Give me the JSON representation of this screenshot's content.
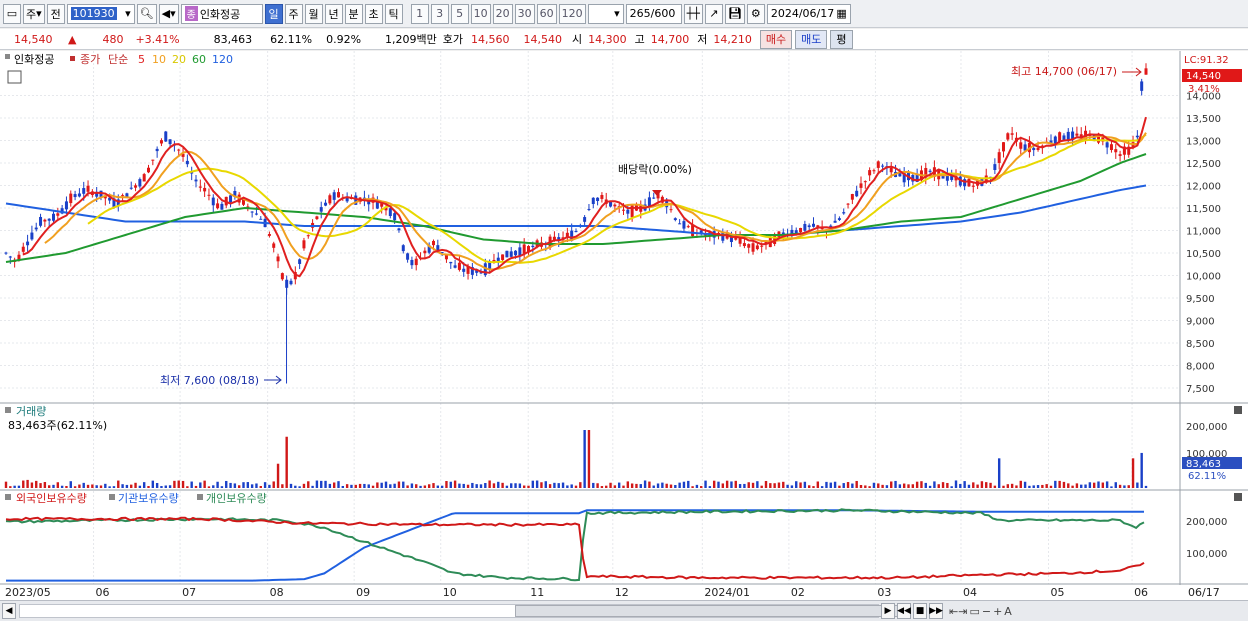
{
  "toolbar": {
    "market_a": "주",
    "market_b": "전",
    "code": "101930",
    "name_badge": "종",
    "name": "인화정공",
    "periods": [
      "일",
      "주",
      "월",
      "년",
      "분",
      "초",
      "틱"
    ],
    "numbers": [
      "1",
      "3",
      "5",
      "10",
      "20",
      "30",
      "60",
      "120"
    ],
    "count": "265",
    "count_total": "/600",
    "date": "2024/06/17"
  },
  "quote": {
    "price": "14,540",
    "change": "480",
    "change_pct": "+3.41%",
    "volume": "83,463",
    "vol_ratio": "62.11%",
    "turnover": "0.92%",
    "amount": "1,209백만",
    "ask_label": "호가",
    "ask": "14,560",
    "bid": "14,540",
    "open_label": "시",
    "open": "14,300",
    "high_label": "고",
    "high": "14,700",
    "low_label": "저",
    "low": "14,210",
    "buy": "매수",
    "sell": "매도",
    "eval": "평"
  },
  "legend": {
    "name": "인화정공",
    "close_label": "종가",
    "simple_label": "단순",
    "ma": [
      {
        "label": "5",
        "color": "#e02020"
      },
      {
        "label": "10",
        "color": "#f0a020"
      },
      {
        "label": "20",
        "color": "#e8d800"
      },
      {
        "label": "60",
        "color": "#209a30"
      },
      {
        "label": "120",
        "color": "#2060e0"
      }
    ]
  },
  "annotations": {
    "lc": "LC:91.32",
    "max": "최고 14,700 (06/17)",
    "min": "최저 7,600 (08/18)",
    "dividend": "배당락(0.00%)",
    "price_tag": "14,540",
    "pct_tag": "3.41%"
  },
  "volume_panel": {
    "title": "거래량",
    "value": "83,463주(62.11%)",
    "tag": "83,463",
    "tag_pct": "62.11%",
    "ticks": [
      "200,000",
      "100,000"
    ]
  },
  "holder_panel": {
    "series": [
      "외국인보유수량",
      "기관보유수량",
      "개인보유수량"
    ],
    "colors": [
      "#d01818",
      "#2060e0",
      "#2e8b57"
    ],
    "ticks": [
      "200,000",
      "100,000"
    ]
  },
  "x_axis": {
    "labels": [
      "2023/05",
      "06",
      "07",
      "08",
      "09",
      "10",
      "11",
      "12",
      "2024/01",
      "02",
      "03",
      "04",
      "05",
      "06",
      "06/17"
    ]
  },
  "y_axis": {
    "price_ticks": [
      "14,000",
      "13,500",
      "13,000",
      "12,500",
      "12,000",
      "11,500",
      "11,000",
      "10,500",
      "10,000",
      "9,500",
      "9,000",
      "8,500",
      "8,000",
      "7,500"
    ]
  },
  "chart_data": {
    "type": "candlestick",
    "title": "",
    "ylim": [
      7300,
      14900
    ],
    "price_trend": [
      [
        0,
        10500
      ],
      [
        10,
        10300
      ],
      [
        20,
        10700
      ],
      [
        35,
        11200
      ],
      [
        50,
        11300
      ],
      [
        65,
        11700
      ],
      [
        80,
        11900
      ],
      [
        95,
        11800
      ],
      [
        110,
        11600
      ],
      [
        125,
        11900
      ],
      [
        140,
        12200
      ],
      [
        150,
        12700
      ],
      [
        160,
        13100
      ],
      [
        170,
        12900
      ],
      [
        180,
        12600
      ],
      [
        190,
        12100
      ],
      [
        200,
        11900
      ],
      [
        215,
        11500
      ],
      [
        230,
        11800
      ],
      [
        245,
        11500
      ],
      [
        260,
        11200
      ],
      [
        270,
        10600
      ],
      [
        280,
        9800
      ],
      [
        290,
        9900
      ],
      [
        300,
        10700
      ],
      [
        315,
        11400
      ],
      [
        330,
        11800
      ],
      [
        345,
        11700
      ],
      [
        360,
        11700
      ],
      [
        375,
        11600
      ],
      [
        390,
        11400
      ],
      [
        400,
        10600
      ],
      [
        410,
        10200
      ],
      [
        420,
        10500
      ],
      [
        430,
        10700
      ],
      [
        440,
        10500
      ],
      [
        450,
        10200
      ],
      [
        465,
        10100
      ],
      [
        480,
        10100
      ],
      [
        495,
        10400
      ],
      [
        510,
        10500
      ],
      [
        525,
        10600
      ],
      [
        540,
        10700
      ],
      [
        555,
        10800
      ],
      [
        570,
        10900
      ],
      [
        580,
        11200
      ],
      [
        590,
        11700
      ],
      [
        600,
        11700
      ],
      [
        615,
        11500
      ],
      [
        625,
        11400
      ],
      [
        640,
        11500
      ],
      [
        655,
        11800
      ],
      [
        665,
        11600
      ],
      [
        675,
        11200
      ],
      [
        690,
        11000
      ],
      [
        705,
        10900
      ],
      [
        720,
        10900
      ],
      [
        735,
        10800
      ],
      [
        750,
        10600
      ],
      [
        765,
        10700
      ],
      [
        780,
        10900
      ],
      [
        795,
        11000
      ],
      [
        810,
        11100
      ],
      [
        825,
        11000
      ],
      [
        840,
        11300
      ],
      [
        850,
        11700
      ],
      [
        860,
        12000
      ],
      [
        870,
        12300
      ],
      [
        880,
        12500
      ],
      [
        890,
        12300
      ],
      [
        900,
        12200
      ],
      [
        915,
        12200
      ],
      [
        930,
        12300
      ],
      [
        945,
        12200
      ],
      [
        960,
        12100
      ],
      [
        975,
        12000
      ],
      [
        990,
        12200
      ],
      [
        1000,
        12700
      ],
      [
        1010,
        13200
      ],
      [
        1020,
        12900
      ],
      [
        1035,
        12800
      ],
      [
        1050,
        13000
      ],
      [
        1065,
        13100
      ],
      [
        1080,
        13100
      ],
      [
        1095,
        13100
      ],
      [
        1110,
        12900
      ],
      [
        1120,
        12700
      ],
      [
        1130,
        12800
      ],
      [
        1137,
        13000
      ],
      [
        1142,
        14300
      ],
      [
        1146,
        14540
      ]
    ],
    "ma60": [
      [
        0,
        10300
      ],
      [
        60,
        10500
      ],
      [
        120,
        10900
      ],
      [
        180,
        11300
      ],
      [
        240,
        11500
      ],
      [
        300,
        11400
      ],
      [
        360,
        11300
      ],
      [
        420,
        11100
      ],
      [
        480,
        10800
      ],
      [
        540,
        10700
      ],
      [
        600,
        10700
      ],
      [
        660,
        10800
      ],
      [
        720,
        10900
      ],
      [
        780,
        10900
      ],
      [
        840,
        11000
      ],
      [
        900,
        11200
      ],
      [
        960,
        11300
      ],
      [
        1020,
        11700
      ],
      [
        1080,
        12100
      ],
      [
        1120,
        12500
      ],
      [
        1146,
        12700
      ]
    ],
    "ma120": [
      [
        0,
        11600
      ],
      [
        60,
        11400
      ],
      [
        120,
        11200
      ],
      [
        180,
        11200
      ],
      [
        240,
        11200
      ],
      [
        300,
        11100
      ],
      [
        360,
        11100
      ],
      [
        420,
        11100
      ],
      [
        480,
        11100
      ],
      [
        540,
        11100
      ],
      [
        600,
        11100
      ],
      [
        660,
        11000
      ],
      [
        720,
        10900
      ],
      [
        780,
        10900
      ],
      [
        840,
        11000
      ],
      [
        900,
        11100
      ],
      [
        960,
        11200
      ],
      [
        1020,
        11400
      ],
      [
        1080,
        11700
      ],
      [
        1120,
        11900
      ],
      [
        1146,
        12000
      ]
    ],
    "volume_spikes": [
      [
        20,
        30000
      ],
      [
        272,
        90000
      ],
      [
        282,
        190000
      ],
      [
        584,
        215000
      ],
      [
        998,
        110000
      ],
      [
        1133,
        110000
      ],
      [
        1140,
        130000
      ]
    ],
    "foreign": [
      [
        0,
        220000
      ],
      [
        100,
        220000
      ],
      [
        200,
        220000
      ],
      [
        300,
        205000
      ],
      [
        360,
        203000
      ],
      [
        420,
        200000
      ],
      [
        500,
        200000
      ],
      [
        578,
        200000
      ],
      [
        580,
        80000
      ],
      [
        582,
        20000
      ],
      [
        700,
        15000
      ],
      [
        800,
        15000
      ],
      [
        900,
        15000
      ],
      [
        980,
        25000
      ],
      [
        1060,
        30000
      ],
      [
        1120,
        40000
      ],
      [
        1146,
        65000
      ]
    ],
    "institution": [
      [
        0,
        5000
      ],
      [
        250,
        5000
      ],
      [
        300,
        10000
      ],
      [
        320,
        30000
      ],
      [
        360,
        120000
      ],
      [
        420,
        200000
      ],
      [
        450,
        240000
      ],
      [
        500,
        240000
      ],
      [
        578,
        240000
      ],
      [
        582,
        250000
      ],
      [
        700,
        250000
      ],
      [
        850,
        250000
      ],
      [
        980,
        245000
      ],
      [
        1146,
        245000
      ]
    ],
    "individual": [
      [
        0,
        210000
      ],
      [
        100,
        215000
      ],
      [
        200,
        220000
      ],
      [
        280,
        215000
      ],
      [
        320,
        190000
      ],
      [
        360,
        140000
      ],
      [
        420,
        70000
      ],
      [
        450,
        30000
      ],
      [
        500,
        15000
      ],
      [
        578,
        10000
      ],
      [
        580,
        150000
      ],
      [
        582,
        240000
      ],
      [
        700,
        245000
      ],
      [
        850,
        250000
      ],
      [
        980,
        240000
      ],
      [
        1000,
        215000
      ],
      [
        1060,
        215000
      ],
      [
        1120,
        215000
      ],
      [
        1135,
        190000
      ],
      [
        1146,
        210000
      ]
    ]
  }
}
